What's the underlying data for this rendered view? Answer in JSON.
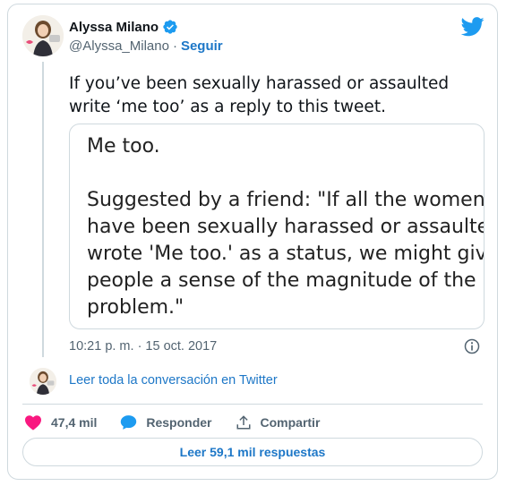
{
  "tweet": {
    "author": {
      "name": "Alyssa Milano",
      "handle": "@Alyssa_Milano",
      "separator": "·",
      "follow_label": "Seguir",
      "verified_icon": "verified-badge-icon",
      "verified_color": "#1d9bf0"
    },
    "text": "If you’ve been sexually harassed or assaulted write ‘me too’ as a reply to this tweet.",
    "media": {
      "lines": [
        "Me too.",
        "",
        "Suggested by a friend: \"If all the women w",
        "have been sexually harassed or assaulted",
        "wrote 'Me too.' as a status, we might give",
        "people a sense of the magnitude of the",
        "problem.\""
      ]
    },
    "timestamp": "10:21 p. m. · 15 oct. 2017",
    "conversation_link": "Leer toda la conversación en Twitter",
    "actions": {
      "likes": "47,4 mil",
      "reply_label": "Responder",
      "share_label": "Compartir"
    },
    "read_replies_label": "Leer 59,1 mil respuestas"
  },
  "colors": {
    "link": "#1d77c7",
    "like": "#f91880",
    "reply_icon": "#1d9bf0",
    "twitter_brand": "#1d9bf0",
    "border": "#cfd9de",
    "muted_text": "#536471"
  }
}
